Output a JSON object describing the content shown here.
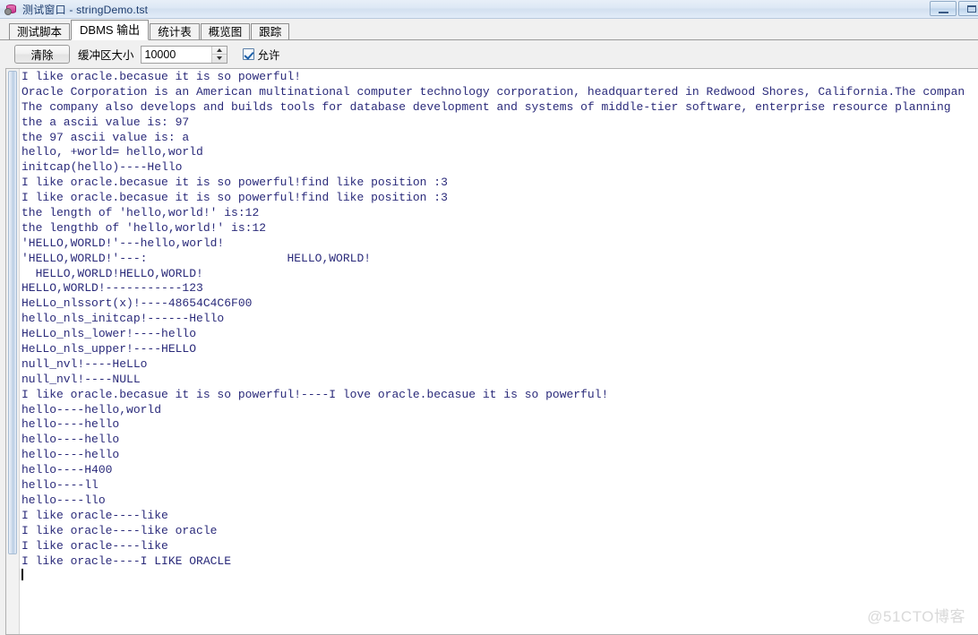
{
  "window": {
    "title": "测试窗口 - stringDemo.tst",
    "icon": "database-gear-icon",
    "buttons": [
      {
        "name": "minimize",
        "glyph": "minimize-icon"
      },
      {
        "name": "maximize",
        "glyph": "maximize-icon"
      }
    ]
  },
  "tabs": [
    {
      "label": "测试脚本",
      "active": false,
      "key": "test-script"
    },
    {
      "label": "DBMS 输出",
      "active": true,
      "key": "dbms-output"
    },
    {
      "label": "统计表",
      "active": false,
      "key": "statistics"
    },
    {
      "label": "概览图",
      "active": false,
      "key": "overview"
    },
    {
      "label": "跟踪",
      "active": false,
      "key": "trace"
    }
  ],
  "toolbar": {
    "clear_label": "清除",
    "buffer_label": "缓冲区大小",
    "buffer_value": "10000",
    "enable_label": "允许",
    "enable_checked": true
  },
  "output": {
    "lines": [
      "I like oracle.becasue it is so powerful!",
      "Oracle Corporation is an American multinational computer technology corporation, headquartered in Redwood Shores, California.The compan",
      "The company also develops and builds tools for database development and systems of middle-tier software, enterprise resource planning",
      "the a ascii value is: 97",
      "the 97 ascii value is: a",
      "hello, +world= hello,world",
      "initcap(hello)----Hello",
      "I like oracle.becasue it is so powerful!find like position :3",
      "I like oracle.becasue it is so powerful!find like position :3",
      "the length of 'hello,world!' is:12",
      "the lengthb of 'hello,world!' is:12",
      "'HELLO,WORLD!'---hello,world!",
      "'HELLO,WORLD!'---:                    HELLO,WORLD!",
      "  HELLO,WORLD!HELLO,WORLD!",
      "HELLO,WORLD!-----------123",
      "HeLLo_nlssort(x)!----48654C4C6F00",
      "hello_nls_initcap!------Hello",
      "HeLLo_nls_lower!----hello",
      "HeLLo_nls_upper!----HELLO",
      "null_nvl!----HeLLo",
      "null_nvl!----NULL",
      "I like oracle.becasue it is so powerful!----I love oracle.becasue it is so powerful!",
      "hello----hello,world",
      "hello----hello",
      "hello----hello",
      "hello----hello",
      "hello----H400",
      "hello----ll",
      "hello----llo",
      "I like oracle----like",
      "I like oracle----like oracle",
      "I like oracle----like",
      "I like oracle----I LIKE ORACLE"
    ]
  },
  "watermark": "@51CTO博客",
  "colors": {
    "text": "#2a2a7a",
    "titlebar": "#dde8f5",
    "chrome": "#f0f0f0",
    "accent": "#1c5fa8"
  }
}
